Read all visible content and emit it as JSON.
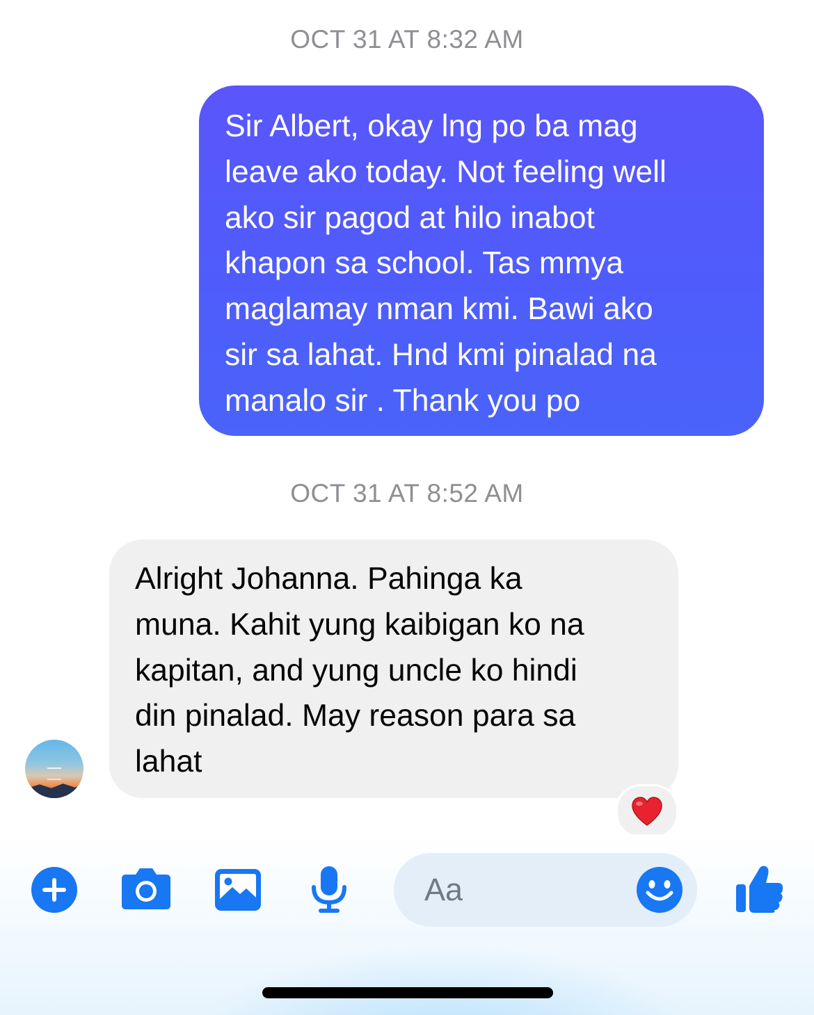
{
  "messages": [
    {
      "timestamp": "OCT 31 AT 8:32 AM",
      "direction": "outgoing",
      "lines": [
        "Sir Albert, okay lng po ba mag",
        "leave ako today. Not feeling well",
        "ako sir pagod at hilo inabot",
        "khapon sa school. Tas mmya",
        "maglamay nman kmi. Bawi ako",
        "sir sa lahat. Hnd kmi pinalad na",
        "manalo sir . Thank you po"
      ]
    },
    {
      "timestamp": "OCT 31 AT 8:52 AM",
      "direction": "incoming",
      "lines": [
        "Alright Johanna. Pahinga ka",
        "muna. Kahit yung kaibigan ko na",
        "kapitan, and yung uncle ko hindi",
        "din pinalad. May reason para sa",
        "lahat"
      ],
      "reaction": "❤️"
    }
  ],
  "composer": {
    "placeholder": "Aa",
    "icons": [
      "plus-icon",
      "camera-icon",
      "image-icon",
      "microphone-icon",
      "emoji-icon",
      "thumbs-up-icon"
    ]
  },
  "colors": {
    "outgoing_bubble": "#5359fb",
    "incoming_bubble": "#f0f0f0",
    "accent": "#1877f2"
  }
}
